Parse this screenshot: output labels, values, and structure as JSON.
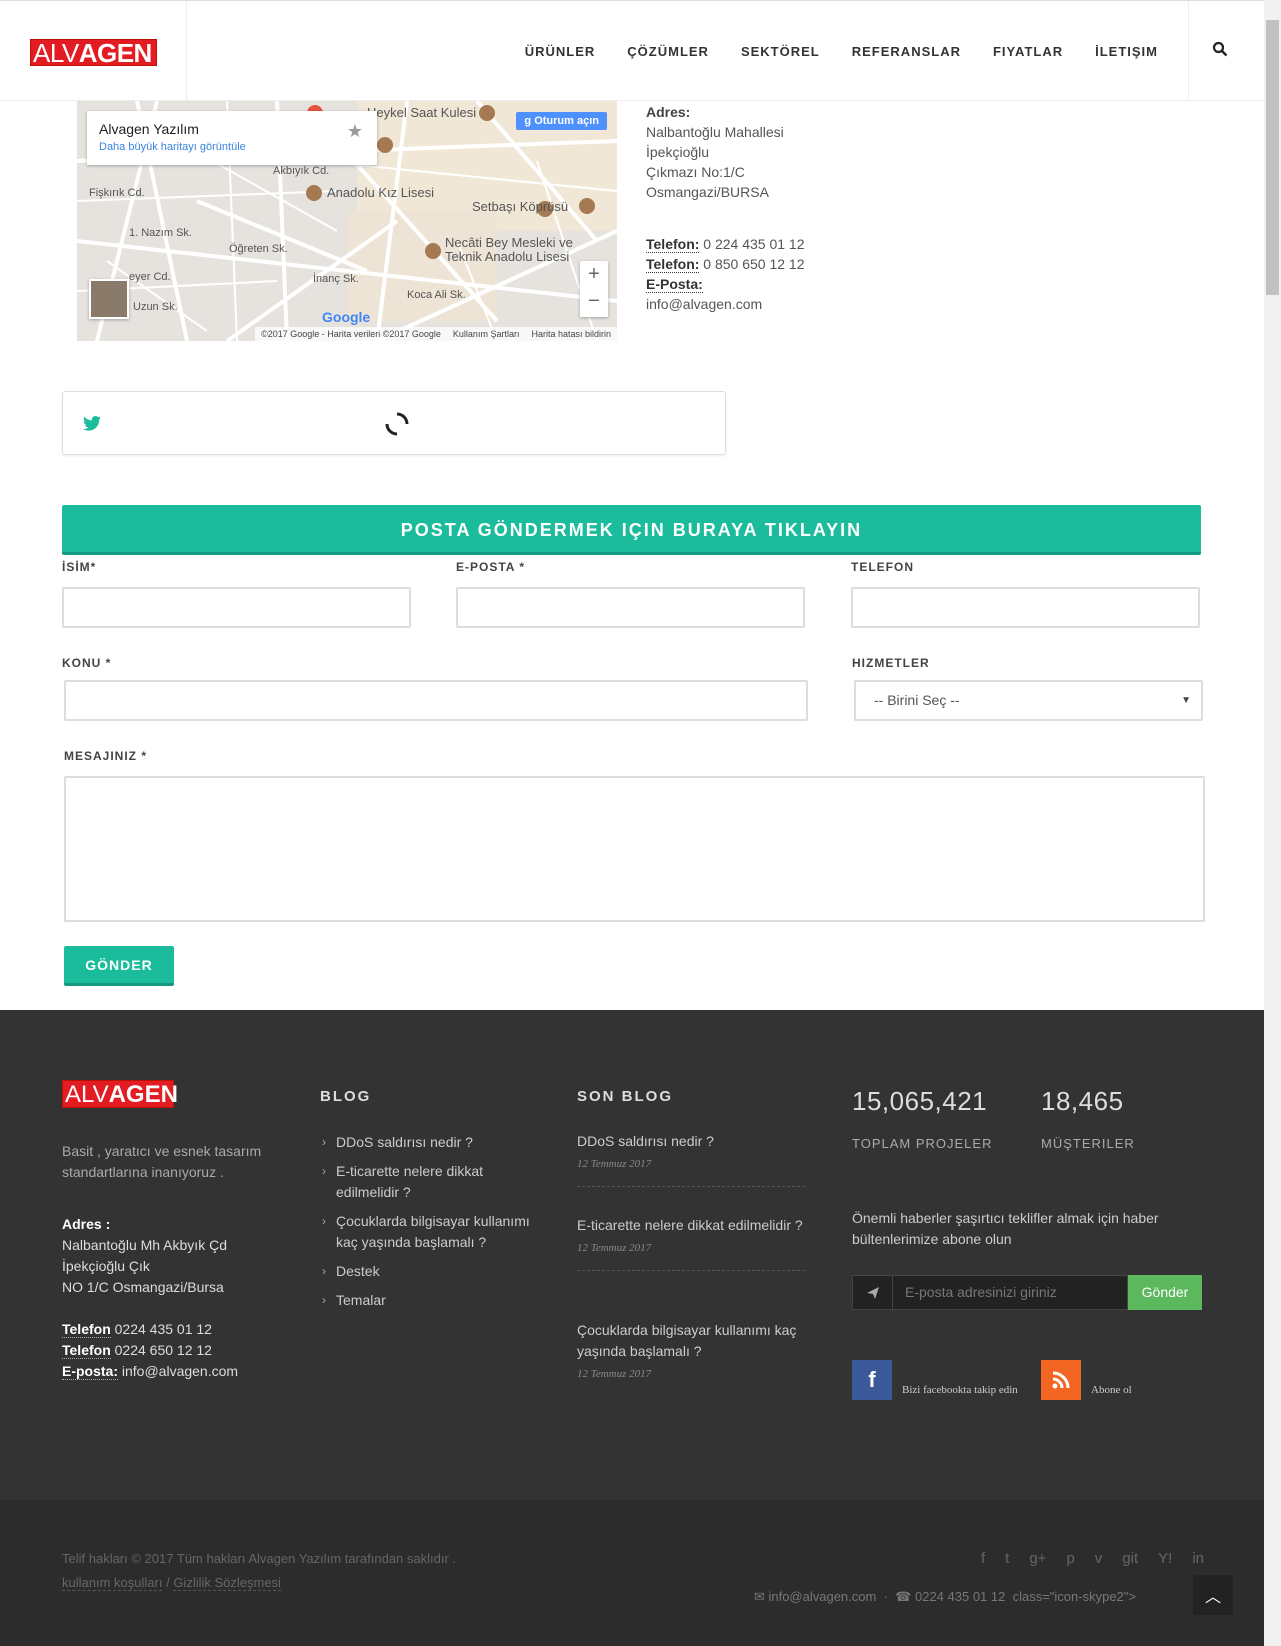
{
  "header": {
    "logo_light": "ALV",
    "logo_bold": "AGEN",
    "nav": [
      "ÜRÜNLER",
      "ÇÖZÜMLER",
      "SEKTÖREL",
      "REFERANSLAR",
      "FIYATLAR",
      "İLETIŞIM"
    ]
  },
  "map": {
    "card_title": "Alvagen Yazılım",
    "card_link": "Daha büyük haritayı görüntüle",
    "login": "Oturum açın",
    "labels": [
      "Heykel Saat Kulesi",
      "Anadolu Kız Lisesi",
      "Setbaşı Köprüsü",
      "Necâti Bey Mesleki ve",
      "Teknik Anadolu Lisesi",
      "Öğreten Sk.",
      "İnanç Sk.",
      "Koca Ali Sk.",
      "1. Nazım Sk.",
      "Akbıyık Cd.",
      "Fişkırık Cd.",
      "eyer Cd.",
      "Uzun Sk."
    ],
    "zoom_in": "+",
    "zoom_out": "−",
    "google": "Google",
    "footer": [
      "©2017 Google - Harita verileri ©2017 Google",
      "Kullanım Şartları",
      "Harita hatası bildirin"
    ]
  },
  "contact": {
    "address_label": "Adres:",
    "address_lines": [
      "Nalbantoğlu Mahallesi",
      "İpekçioğlu",
      "Çıkmazı No:1/C",
      "Osmangazi/BURSA"
    ],
    "phone_label": "Telefon:",
    "phone1": "0 224 435 01 12",
    "phone2": "0 850 650 12 12",
    "email_label": "E-Posta:",
    "email": "info@alvagen.com"
  },
  "form": {
    "cta": "POSTA GÖNDERMEK IÇIN BURAYA TIKLAYIN",
    "name_label": "İSİM*",
    "email_label": "E-POSTA *",
    "phone_label": "TELEFON",
    "subject_label": "KONU *",
    "services_label": "HIZMETLER",
    "services_selected": "-- Birini Seç --",
    "message_label": "MESAJINIZ *",
    "send": "GÖNDER"
  },
  "footer": {
    "logo_light": "ALV",
    "logo_bold": "AGEN",
    "tagline": [
      "Basit , yaratıcı ve esnek tasarım",
      "standartlarına inanıyoruz ."
    ],
    "address_label": "Adres :",
    "address_lines": [
      "Nalbantoğlu Mh Akbyık Çd",
      "İpekçioğlu Çık",
      "NO 1/C Osmangazi/Bursa"
    ],
    "phone_label": "Telefon",
    "phone1": "0224 435 01 12",
    "phone2": "0224 650 12 12",
    "email_label": "E-posta:",
    "email": "info@alvagen.com",
    "blog_heading": "BLOG",
    "blog_items": [
      "DDoS saldırısı nedir ?",
      "E-ticarette nelere dikkat edilmelidir ?",
      "Çocuklarda bilgisayar kullanımı kaç yaşında başlamalı ?",
      "Destek",
      "Temalar"
    ],
    "recent_heading": "SON BLOG",
    "recent": [
      {
        "title": "DDoS saldırısı nedir ?",
        "date": "12 Temmuz 2017"
      },
      {
        "title": "E-ticarette nelere dikkat edilmelidir ?",
        "date": "12 Temmuz 2017"
      },
      {
        "title": "Çocuklarda bilgisayar kullanımı kaç yaşında başlamalı ?",
        "date": "12 Temmuz 2017"
      }
    ],
    "stat1_num": "15,065,421",
    "stat1_label": "TOPLAM PROJELER",
    "stat2_num": "18,465",
    "stat2_label": "MÜŞTERILER",
    "newsletter_text": "Önemli haberler şaşırtıcı teklifler almak için haber bültenlerimize abone olun",
    "newsletter_placeholder": "E-posta adresinizi giriniz",
    "newsletter_button": "Gönder",
    "facebook_text": "Bizi facebookta takip edin",
    "rss_text": "Abone ol",
    "copyright": "Telif hakları © 2017 Tüm hakları Alvagen Yazılım tarafından saklıdır .",
    "terms": "kullanım koşulları",
    "separator": "/",
    "privacy": "Gizlilik Sözleşmesi",
    "bottom_email": "info@alvagen.com",
    "bottom_dot": "·",
    "bottom_phone": "0224 435 01 12",
    "bottom_extra": "class=\"icon-skype2\">",
    "social_icons": [
      "f",
      "t",
      "g+",
      "p",
      "v",
      "git",
      "Y!",
      "in"
    ],
    "colors": {
      "footer_bg": "#333333",
      "accent": "#1abc9c",
      "brand": "#e31b23"
    }
  }
}
